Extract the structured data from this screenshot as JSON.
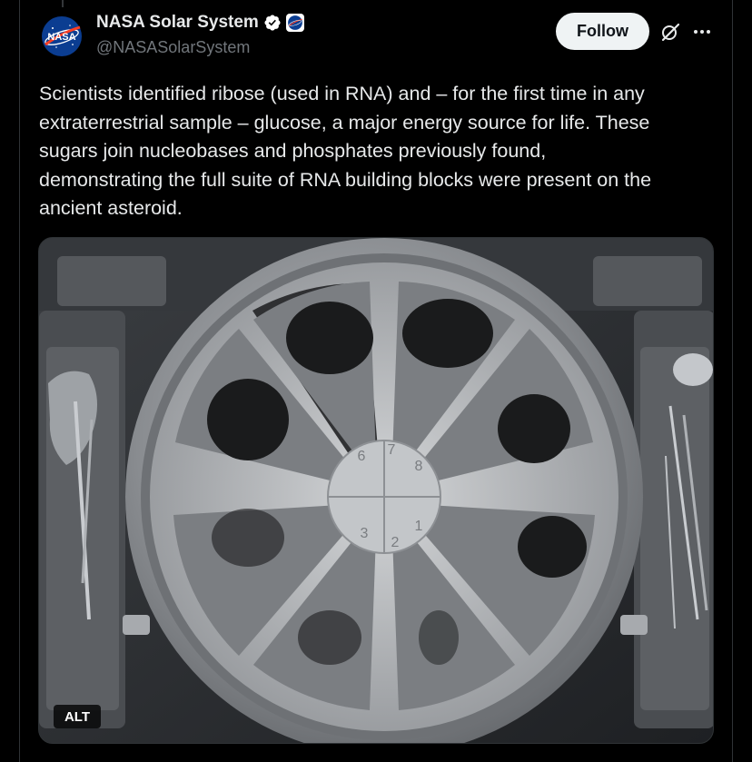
{
  "post": {
    "author": {
      "display_name": "NASA Solar System",
      "handle": "@NASASolarSystem",
      "avatar_icon": "nasa-meatball-logo",
      "verified_icon": "verified-badge-icon",
      "affiliate_icon": "nasa-affiliate-badge-icon"
    },
    "actions": {
      "follow_label": "Follow",
      "grok_icon": "grok-icon",
      "more_icon": "more-options-icon"
    },
    "text": "Scientists identified ribose (used in RNA) and – for the first time in any\nextraterrestrial sample – glucose, a major energy source for life. These\nsugars join nucleobases and phosphates previously found,\ndemonstrating the full suite of RNA building blocks were present on the\nancient asteroid.",
    "media": {
      "alt_label": "ALT",
      "tray_numbers": [
        "6",
        "7",
        "8",
        "1",
        "2",
        "3"
      ]
    }
  },
  "colors": {
    "background": "#000000",
    "text": "#e7e9ea",
    "secondary_text": "#71767b",
    "follow_bg": "#eff3f4",
    "verified_blue": "#1d9bf0"
  }
}
